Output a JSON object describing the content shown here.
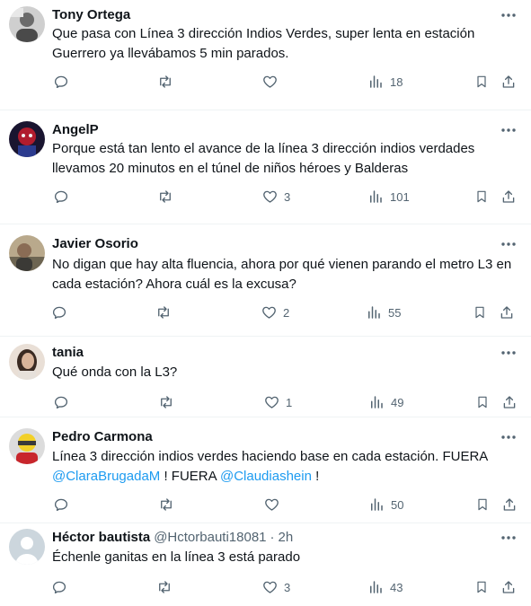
{
  "tweets": [
    {
      "name": "Tony Ortega",
      "handle": "",
      "dot": "",
      "time": "",
      "text": "Que pasa con Línea 3 dirección Indios Verdes, super lenta en estación Guerrero ya llevábamos 5 min parados.",
      "likes": "",
      "views": "18",
      "avatar_icon": "avatar-photo-icon"
    },
    {
      "name": "AngelP",
      "handle": "",
      "dot": "",
      "time": "",
      "text": "Porque está tan lento el avance de la línea 3 dirección indios verdades llevamos 20 minutos en el túnel de niños héroes y Balderas",
      "likes": "3",
      "views": "101",
      "avatar_icon": "avatar-photo-icon"
    },
    {
      "name": "Javier Osorio",
      "handle": "",
      "dot": "",
      "time": "",
      "text": "No digan que hay alta fluencia, ahora por qué vienen parando el metro L3 en cada estación? Ahora cuál es la excusa?",
      "likes": "2",
      "views": "55",
      "avatar_icon": "avatar-photo-icon"
    },
    {
      "name": "tania",
      "handle": "",
      "dot": "",
      "time": "",
      "text": "Qué onda con la L3?",
      "likes": "1",
      "views": "49",
      "avatar_icon": "avatar-photo-icon"
    },
    {
      "name": "Pedro Carmona",
      "handle": "",
      "dot": "",
      "time": "",
      "text_parts": [
        "Línea 3 dirección indios verdes haciendo base en cada estación. FUERA ",
        "@ClaraBrugadaM",
        " ! FUERA ",
        "@Claudiashein",
        " !"
      ],
      "likes": "",
      "views": "50",
      "avatar_icon": "avatar-photo-icon"
    },
    {
      "name": "Héctor bautista",
      "handle": "@Hctorbauti18081",
      "dot": "·",
      "time": "2h",
      "text": "Échenle ganitas en la línea 3 está parado",
      "likes": "3",
      "views": "43",
      "avatar_icon": "default-avatar-icon"
    }
  ],
  "colors": {
    "text": "#0f1419",
    "secondary": "#536471",
    "link": "#1d9bf0",
    "divider": "#eff3f4"
  },
  "icons": [
    "more-icon",
    "reply-icon",
    "retweet-icon",
    "like-icon",
    "views-icon",
    "bookmark-icon",
    "share-icon"
  ]
}
